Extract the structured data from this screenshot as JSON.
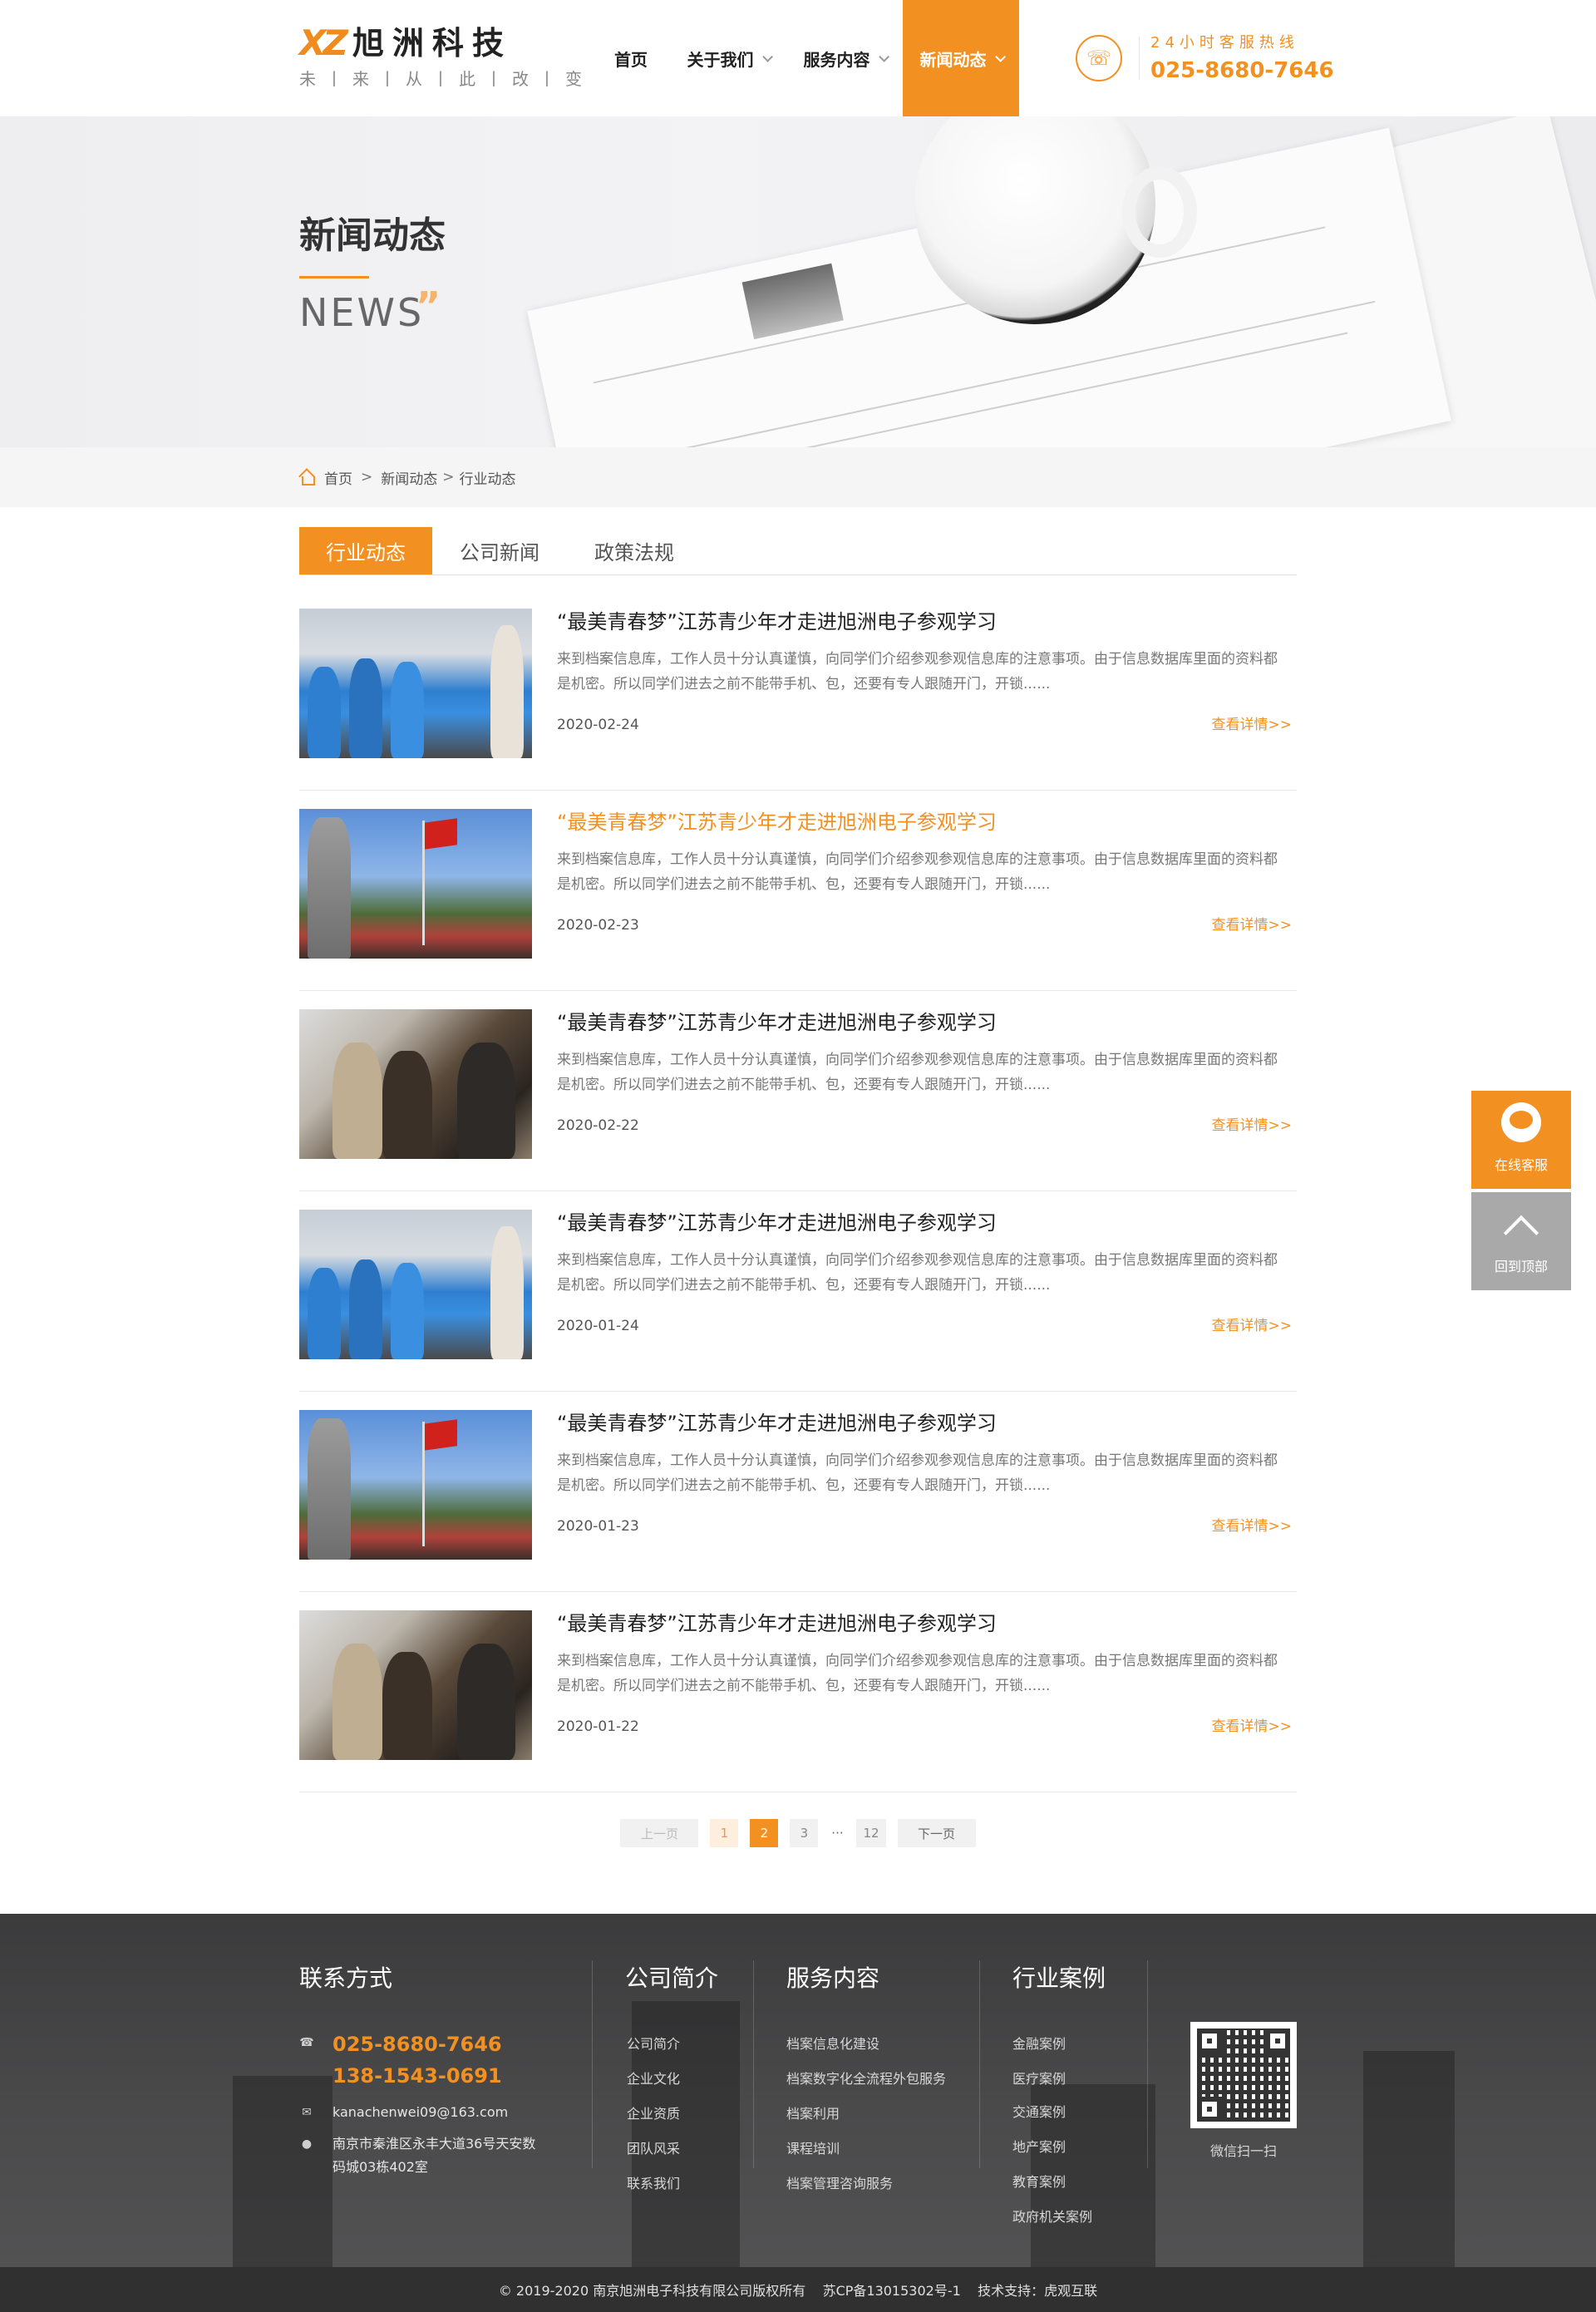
{
  "header": {
    "logo_mark": "XZ",
    "logo_name": "旭洲科技",
    "slogan": "未丨来丨从丨此丨改丨变",
    "nav": [
      {
        "label": "首页"
      },
      {
        "label": "关于我们"
      },
      {
        "label": "服务内容"
      },
      {
        "label": "新闻动态"
      }
    ],
    "hotline_label": "24小时客服热线",
    "hotline_number": "025-8680-7646"
  },
  "banner": {
    "title": "新闻动态",
    "subtitle": "NEWS",
    "quote_mark": "”"
  },
  "breadcrumb": {
    "home": "首页",
    "sep": ">",
    "level1": "新闻动态",
    "level2": "行业动态"
  },
  "tabs": [
    {
      "label": "行业动态",
      "active": true
    },
    {
      "label": "公司新闻",
      "active": false
    },
    {
      "label": "政策法规",
      "active": false
    }
  ],
  "news": [
    {
      "title": "“最美青春梦”江苏青少年才走进旭洲电子参观学习",
      "desc": "来到档案信息库，工作人员十分认真谨慎，向同学们介绍参观参观信息库的注意事项。由于信息数据库里面的资料都是机密。所以同学们进去之前不能带手机、包，还要有专人跟随开门，开锁......",
      "date": "2020-02-24",
      "more": "查看详情>>"
    },
    {
      "title": "“最美青春梦”江苏青少年才走进旭洲电子参观学习",
      "desc": "来到档案信息库，工作人员十分认真谨慎，向同学们介绍参观参观信息库的注意事项。由于信息数据库里面的资料都是机密。所以同学们进去之前不能带手机、包，还要有专人跟随开门，开锁......",
      "date": "2020-02-23",
      "more": "查看详情>>"
    },
    {
      "title": "“最美青春梦”江苏青少年才走进旭洲电子参观学习",
      "desc": "来到档案信息库，工作人员十分认真谨慎，向同学们介绍参观参观信息库的注意事项。由于信息数据库里面的资料都是机密。所以同学们进去之前不能带手机、包，还要有专人跟随开门，开锁......",
      "date": "2020-02-22",
      "more": "查看详情>>"
    },
    {
      "title": "“最美青春梦”江苏青少年才走进旭洲电子参观学习",
      "desc": "来到档案信息库，工作人员十分认真谨慎，向同学们介绍参观参观信息库的注意事项。由于信息数据库里面的资料都是机密。所以同学们进去之前不能带手机、包，还要有专人跟随开门，开锁......",
      "date": "2020-01-24",
      "more": "查看详情>>"
    },
    {
      "title": "“最美青春梦”江苏青少年才走进旭洲电子参观学习",
      "desc": "来到档案信息库，工作人员十分认真谨慎，向同学们介绍参观参观信息库的注意事项。由于信息数据库里面的资料都是机密。所以同学们进去之前不能带手机、包，还要有专人跟随开门，开锁......",
      "date": "2020-01-23",
      "more": "查看详情>>"
    },
    {
      "title": "“最美青春梦”江苏青少年才走进旭洲电子参观学习",
      "desc": "来到档案信息库，工作人员十分认真谨慎，向同学们介绍参观参观信息库的注意事项。由于信息数据库里面的资料都是机密。所以同学们进去之前不能带手机、包，还要有专人跟随开门，开锁......",
      "date": "2020-01-22",
      "more": "查看详情>>"
    }
  ],
  "pager": {
    "prev": "上一页",
    "pages": [
      "1",
      "2",
      "3"
    ],
    "current": "2",
    "dots": "···",
    "last": "12",
    "next": "下一页"
  },
  "footer": {
    "contact": {
      "title": "联系方式",
      "phone1": "025-8680-7646",
      "phone2": "138-1543-0691",
      "email": "kanachenwei09@163.com",
      "address_line1": "南京市秦淮区永丰大道36号天安数",
      "address_line2": "码城03栋402室"
    },
    "about": {
      "title": "公司简介",
      "links": [
        "公司简介",
        "企业文化",
        "企业资质",
        "团队风采",
        "联系我们"
      ]
    },
    "services": {
      "title": "服务内容",
      "links": [
        "档案信息化建设",
        "档案数字化全流程外包服务",
        "档案利用",
        "课程培训",
        "档案管理咨询服务"
      ]
    },
    "cases": {
      "title": "行业案例",
      "links": [
        "金融案例",
        "医疗案例",
        "交通案例",
        "地产案例",
        "教育案例",
        "政府机关案例"
      ]
    },
    "qr_label": "微信扫一扫",
    "copyright": "© 2019-2020 南京旭洲电子科技有限公司版权所有    苏CP备13015302号-1    技术支持：虎观互联"
  },
  "float": {
    "service": "在线客服",
    "top": "回到顶部"
  },
  "colors": {
    "accent": "#f29122",
    "footer_bg": "#404041"
  }
}
